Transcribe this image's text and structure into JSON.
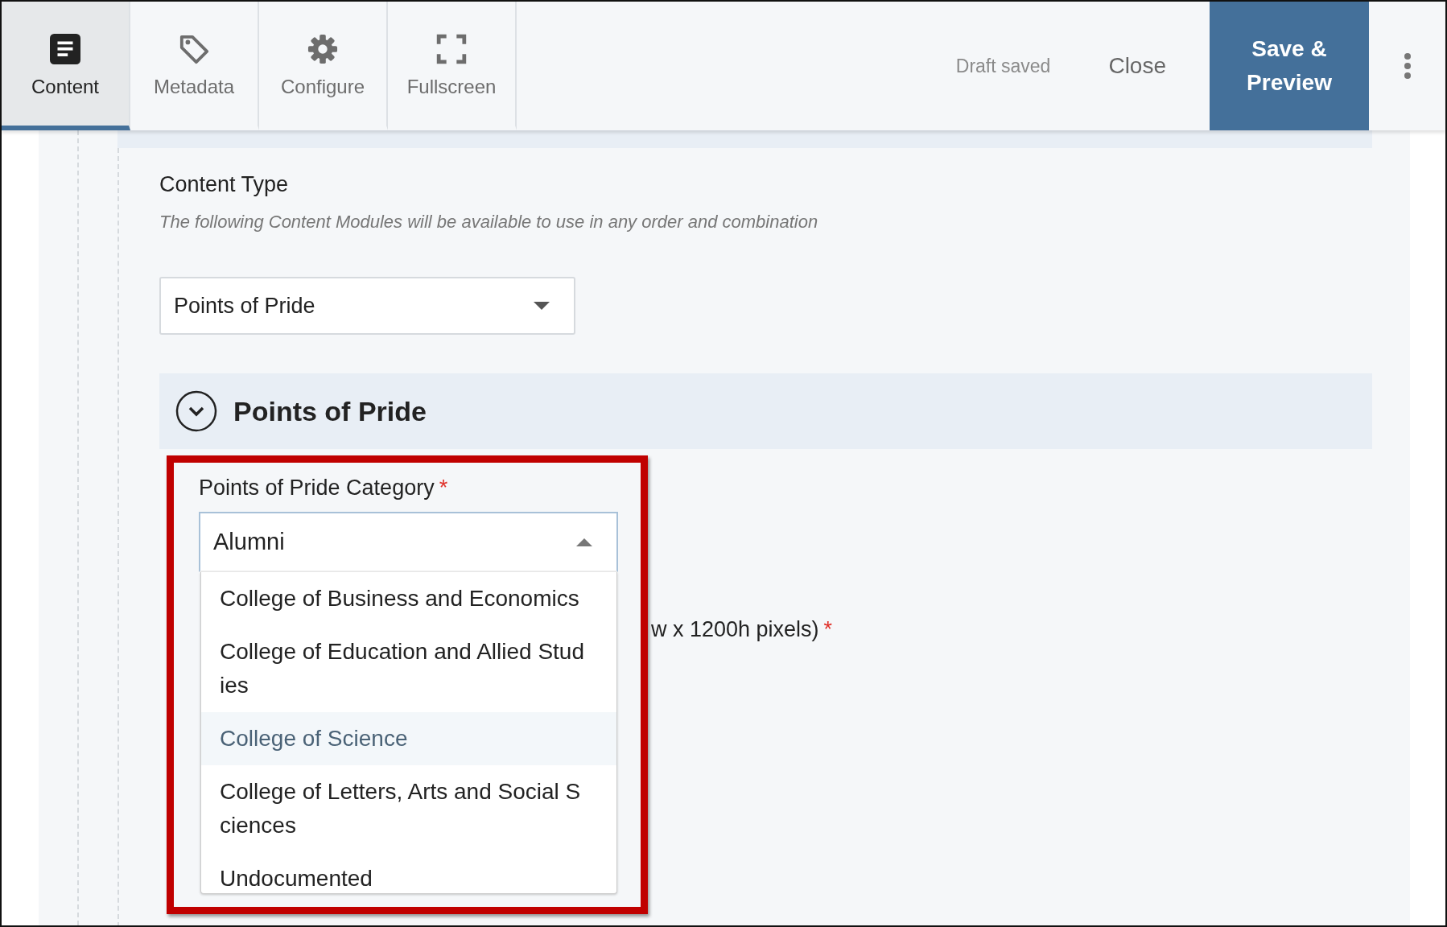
{
  "toolbar": {
    "tabs": [
      {
        "label": "Content",
        "selected": true
      },
      {
        "label": "Metadata",
        "selected": false
      },
      {
        "label": "Configure",
        "selected": false
      },
      {
        "label": "Fullscreen",
        "selected": false
      }
    ],
    "status": "Draft saved",
    "close": "Close",
    "save": "Save & Preview"
  },
  "content_type": {
    "label": "Content Type",
    "hint": "The following Content Modules will be available to use in any order and combination",
    "value": "Points of Pride"
  },
  "section": {
    "title": "Points of Pride",
    "expanded": true
  },
  "category": {
    "label": "Points of Pride Category",
    "required_mark": "*",
    "value": "Alumni",
    "expanded": true,
    "options": [
      {
        "label": "College of Business and Economics",
        "selected": false
      },
      {
        "label": "College of Education and Allied Studies",
        "selected": false
      },
      {
        "label": "College of Science",
        "selected": true
      },
      {
        "label": "College of Letters, Arts and Social Sciences",
        "selected": false
      },
      {
        "label": "Undocumented",
        "selected": false
      }
    ]
  },
  "image_field": {
    "label": "w x 1200h pixels)",
    "required_mark": "*"
  }
}
